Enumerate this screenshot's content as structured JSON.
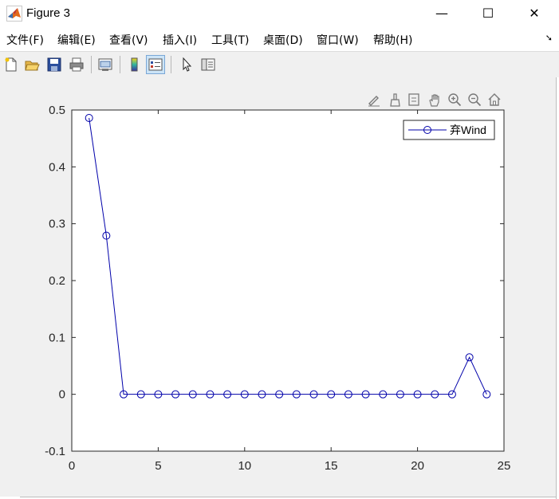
{
  "window": {
    "title": "Figure 3",
    "minimize_glyph": "—",
    "maximize_glyph": "☐",
    "close_glyph": "✕"
  },
  "menu": {
    "items": [
      "文件(F)",
      "编辑(E)",
      "查看(V)",
      "插入(I)",
      "工具(T)",
      "桌面(D)",
      "窗口(W)",
      "帮助(H)"
    ],
    "corner_glyph": "➘"
  },
  "toolbar": {
    "icons": [
      "new-figure-icon",
      "open-file-icon",
      "save-icon",
      "print-icon",
      "link-plot-icon",
      "insert-colorbar-icon",
      "insert-legend-icon",
      "edit-plot-icon",
      "property-inspector-icon"
    ]
  },
  "axes_toolbar": {
    "icons": [
      "brush-edit-icon",
      "data-brush-icon",
      "data-tips-icon",
      "pan-icon",
      "zoom-in-icon",
      "zoom-out-icon",
      "home-icon"
    ]
  },
  "colors": {
    "series": "#0000aa",
    "figure_bg": "#f0f0f0",
    "axes_bg": "#ffffff"
  },
  "chart_data": {
    "type": "line",
    "title": "",
    "xlabel": "",
    "ylabel": "",
    "xlim": [
      0,
      25
    ],
    "ylim": [
      -0.1,
      0.5
    ],
    "xticks": [
      0,
      5,
      10,
      15,
      20,
      25
    ],
    "yticks": [
      -0.1,
      0,
      0.1,
      0.2,
      0.3,
      0.4,
      0.5
    ],
    "xtick_labels": [
      "0",
      "5",
      "10",
      "15",
      "20",
      "25"
    ],
    "ytick_labels": [
      "-0.1",
      "0",
      "0.1",
      "0.2",
      "0.3",
      "0.4",
      "0.5"
    ],
    "grid": false,
    "legend_position": "top-right",
    "marker": "circle",
    "series": [
      {
        "name": "弃Wind",
        "x": [
          1,
          2,
          3,
          4,
          5,
          6,
          7,
          8,
          9,
          10,
          11,
          12,
          13,
          14,
          15,
          16,
          17,
          18,
          19,
          20,
          21,
          22,
          23,
          24
        ],
        "values": [
          0.486,
          0.279,
          0,
          0,
          0,
          0,
          0,
          0,
          0,
          0,
          0,
          0,
          0,
          0,
          0,
          0,
          0,
          0,
          0,
          0,
          0,
          0,
          0.065,
          0
        ]
      }
    ]
  }
}
